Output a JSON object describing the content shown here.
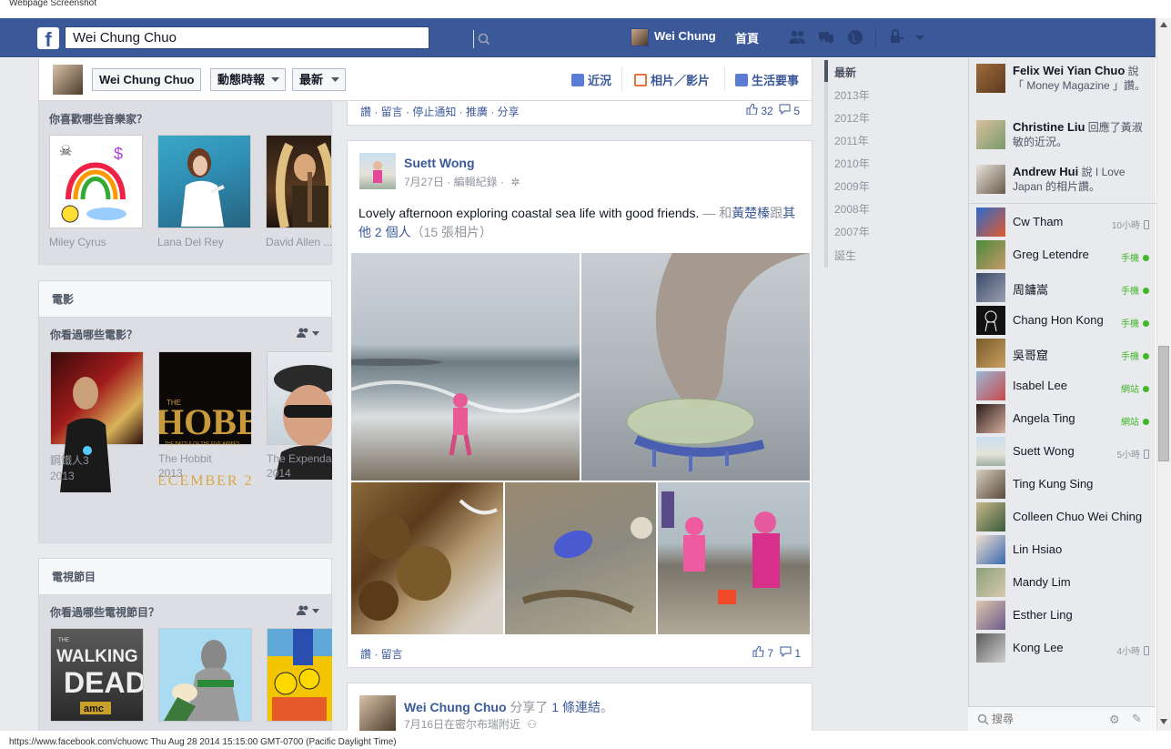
{
  "caption": "Webpage Screenshot",
  "topbar": {
    "logo": "f",
    "search_value": "Wei Chung Chuo",
    "user_name": "Wei Chung",
    "home": "首頁"
  },
  "profile_header": {
    "name_button": "Wei Chung Chuo",
    "timeline_button": "動態時報",
    "recent_button": "最新",
    "links": [
      "近況",
      "相片／影片",
      "生活要事"
    ]
  },
  "left": {
    "music_question": "你喜歡哪些音樂家？",
    "music": [
      {
        "t1": "Miley Cyrus"
      },
      {
        "t1": "Lana Del Rey"
      },
      {
        "t1": "David Allen ..."
      }
    ],
    "movies_title": "電影",
    "movies_question": "你看過哪些電影？",
    "movies": [
      {
        "t1": "鋼鐵人3",
        "t2": "2013"
      },
      {
        "t1": "The Hobbit",
        "t2": "2013"
      },
      {
        "t1": "The Expenda",
        "t2": "2014"
      }
    ],
    "tv_title": "電視節目",
    "tv_question": "你看過哪些電視節目？"
  },
  "feed": {
    "top_actions": "讚 · 留言 · 停止通知 · 推廣 · 分享",
    "top_likes": "32",
    "top_comments": "5",
    "post": {
      "author": "Suett Wong",
      "meta": "7月27日 · 編輯紀錄 ·",
      "text": "Lovely afternoon exploring coastal sea life with good friends.",
      "with_prefix": " — 和",
      "with_name": "黃楚榛",
      "with_mid": "跟",
      "with_others": "其他 2 個人",
      "photo_count": "（15 張相片）",
      "actions": "讚 · 留言",
      "likes": "7",
      "comments": "1"
    },
    "post2": {
      "author": "Wei Chung Chuo",
      "shared": "分享了",
      "link_text": "1 條連結",
      "period": "。",
      "meta": "7月16日在密尔布瑞附近"
    }
  },
  "timeline_nav": [
    "最新",
    "2013年",
    "2012年",
    "2011年",
    "2010年",
    "2009年",
    "2008年",
    "2007年",
    "誕生"
  ],
  "ticker": [
    {
      "name": "Felix Wei Yian Chuo",
      "text": "說「 Money Magazine 」讚。"
    },
    {
      "name": "Christine Liu",
      "text": "回應了黃淑敏的近況。"
    },
    {
      "name": "Andrew Hui",
      "text": "說 I Love Japan 的相片讚。"
    }
  ],
  "friends": [
    {
      "name": "Cw Tham",
      "status": "10小時",
      "kind": "phone"
    },
    {
      "name": "Greg Letendre",
      "status": "手機",
      "kind": "green"
    },
    {
      "name": "周鏞嵩",
      "status": "手機",
      "kind": "green"
    },
    {
      "name": "Chang Hon Kong",
      "status": "手機",
      "kind": "green"
    },
    {
      "name": "吳哥窟",
      "status": "手機",
      "kind": "green"
    },
    {
      "name": "Isabel Lee",
      "status": "網站",
      "kind": "green"
    },
    {
      "name": "Angela Ting",
      "status": "網站",
      "kind": "green"
    },
    {
      "name": "Suett Wong",
      "status": "5小時",
      "kind": "phone"
    },
    {
      "name": "Ting Kung Sing",
      "status": "",
      "kind": "none"
    },
    {
      "name": "Colleen Chuo Wei Ching",
      "status": "",
      "kind": "none"
    },
    {
      "name": "Lin Hsiao",
      "status": "",
      "kind": "none"
    },
    {
      "name": "Mandy Lim",
      "status": "",
      "kind": "none"
    },
    {
      "name": "Esther Ling",
      "status": "",
      "kind": "none"
    },
    {
      "name": "Kong Lee",
      "status": "4小時",
      "kind": "phone"
    }
  ],
  "chat_search_placeholder": "搜尋",
  "status_bar": "https://www.facebook.com/chuowc Thu Aug 28 2014 15:15:00 GMT-0700 (Pacific Daylight Time)",
  "colors": {
    "brand": "#3b5998",
    "online": "#42b72a"
  }
}
